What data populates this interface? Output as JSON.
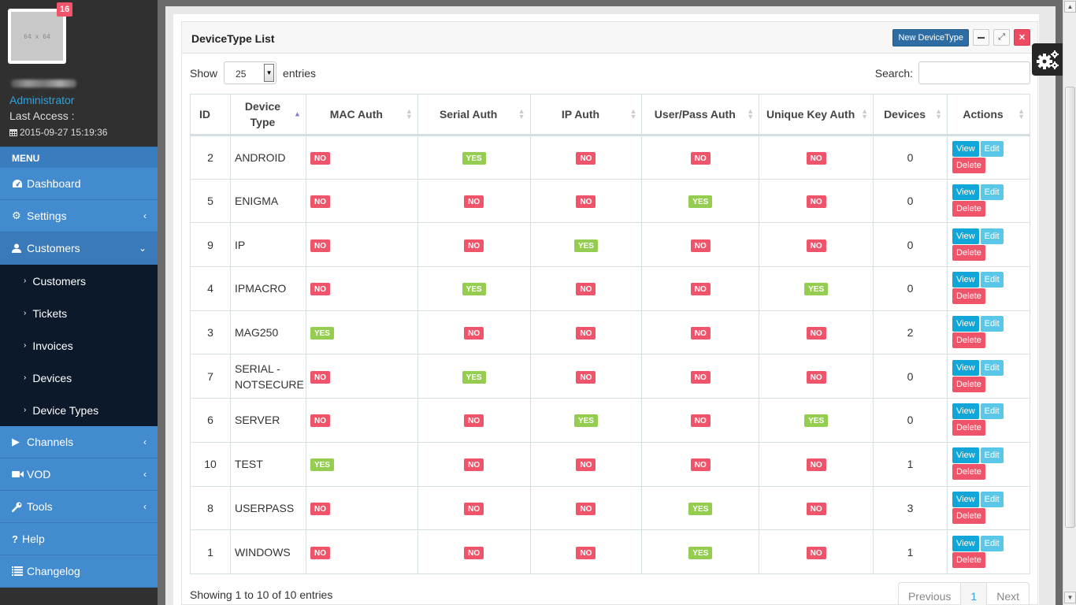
{
  "profile": {
    "avatar_text": "64 x 64",
    "notification_count": "16",
    "role": "Administrator",
    "last_access_label": "Last Access :",
    "last_access_time": "2015-09-27 15:19:36"
  },
  "sidebar": {
    "menu_header": "MENU",
    "items": [
      {
        "label": "Dashboard",
        "icon": "dashboard-icon"
      },
      {
        "label": "Settings",
        "icon": "gear-icon",
        "has_arrow": true
      },
      {
        "label": "Customers",
        "icon": "user-icon",
        "expanded": true
      },
      {
        "label": "Channels",
        "icon": "play-icon",
        "has_arrow": true
      },
      {
        "label": "VOD",
        "icon": "video-camera-icon",
        "has_arrow": true
      },
      {
        "label": "Tools",
        "icon": "wrench-icon",
        "has_arrow": true
      },
      {
        "label": "Help",
        "icon": "question-icon"
      },
      {
        "label": "Changelog",
        "icon": "list-icon"
      }
    ],
    "submenu": [
      "Customers",
      "Tickets",
      "Invoices",
      "Devices",
      "Device Types"
    ]
  },
  "panel": {
    "title": "DeviceType List",
    "new_button": "New DeviceType",
    "show_label": "Show",
    "entries_label": "entries",
    "page_length": "25",
    "search_label": "Search:",
    "search_value": ""
  },
  "table": {
    "columns": [
      "ID",
      "Device Type",
      "MAC Auth",
      "Serial Auth",
      "IP Auth",
      "User/Pass Auth",
      "Unique Key Auth",
      "Devices",
      "Actions"
    ],
    "sorted_column": "Device Type",
    "sort_direction": "asc",
    "rows": [
      {
        "id": "2",
        "type": "ANDROID",
        "mac": "NO",
        "serial": "YES",
        "ip": "NO",
        "userpass": "NO",
        "uniquekey": "NO",
        "devices": "0"
      },
      {
        "id": "5",
        "type": "ENIGMA",
        "mac": "NO",
        "serial": "NO",
        "ip": "NO",
        "userpass": "YES",
        "uniquekey": "NO",
        "devices": "0"
      },
      {
        "id": "9",
        "type": "IP",
        "mac": "NO",
        "serial": "NO",
        "ip": "YES",
        "userpass": "NO",
        "uniquekey": "NO",
        "devices": "0"
      },
      {
        "id": "4",
        "type": "IPMACRO",
        "mac": "NO",
        "serial": "YES",
        "ip": "NO",
        "userpass": "NO",
        "uniquekey": "YES",
        "devices": "0"
      },
      {
        "id": "3",
        "type": "MAG250",
        "mac": "YES",
        "serial": "NO",
        "ip": "NO",
        "userpass": "NO",
        "uniquekey": "NO",
        "devices": "2"
      },
      {
        "id": "7",
        "type": "SERIAL - NOTSECURE",
        "mac": "NO",
        "serial": "YES",
        "ip": "NO",
        "userpass": "NO",
        "uniquekey": "NO",
        "devices": "0"
      },
      {
        "id": "6",
        "type": "SERVER",
        "mac": "NO",
        "serial": "NO",
        "ip": "YES",
        "userpass": "NO",
        "uniquekey": "YES",
        "devices": "0"
      },
      {
        "id": "10",
        "type": "TEST",
        "mac": "YES",
        "serial": "NO",
        "ip": "NO",
        "userpass": "NO",
        "uniquekey": "NO",
        "devices": "1"
      },
      {
        "id": "8",
        "type": "USERPASS",
        "mac": "NO",
        "serial": "NO",
        "ip": "NO",
        "userpass": "YES",
        "uniquekey": "NO",
        "devices": "3"
      },
      {
        "id": "1",
        "type": "WINDOWS",
        "mac": "NO",
        "serial": "NO",
        "ip": "NO",
        "userpass": "YES",
        "uniquekey": "NO",
        "devices": "1"
      }
    ],
    "actions": {
      "view": "View",
      "edit": "Edit",
      "delete": "Delete"
    }
  },
  "footer": {
    "info": "Showing 1 to 10 of 10 entries",
    "previous": "Previous",
    "current_page": "1",
    "next": "Next"
  },
  "colors": {
    "yes": "#95cd50",
    "no": "#f0546a",
    "primary": "#2e6da4",
    "sidebar": "#428bcf"
  }
}
